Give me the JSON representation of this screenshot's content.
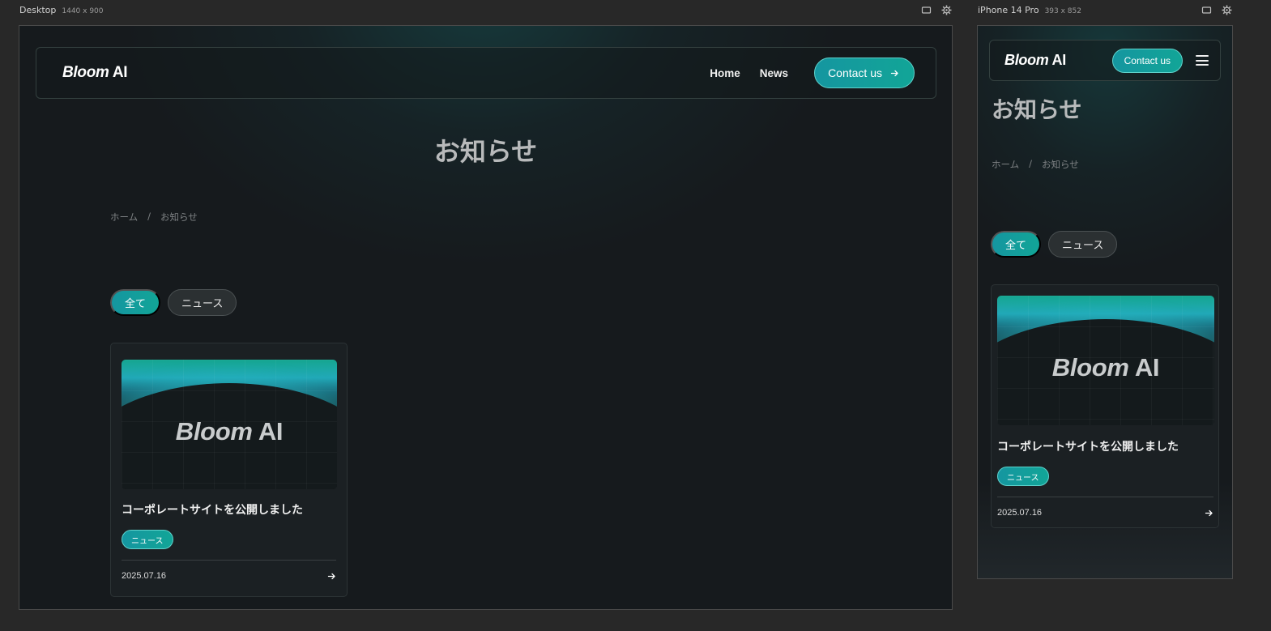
{
  "frames": {
    "desktop": {
      "label": "Desktop",
      "dims": "1440 x 900"
    },
    "mobile": {
      "label": "iPhone 14 Pro",
      "dims": "393 x 852"
    }
  },
  "site": {
    "logo_italic": "Bloom",
    "logo_rest": " AI",
    "nav": [
      {
        "label": "Home"
      },
      {
        "label": "News"
      }
    ],
    "contact_label": "Contact us"
  },
  "page": {
    "title": "お知らせ",
    "breadcrumb": {
      "home": "ホーム",
      "separator": "/",
      "current": "お知らせ"
    }
  },
  "filters": [
    {
      "label": "全て",
      "active": true
    },
    {
      "label": "ニュース",
      "active": false
    }
  ],
  "posts": [
    {
      "thumb_logo_italic": "Bloom",
      "thumb_logo_rest": " AI",
      "title": "コーポレートサイトを公開しました",
      "tag": "ニュース",
      "date": "2025.07.16"
    }
  ],
  "colors": {
    "accent": "#12a597",
    "accent_border": "#5fd3cc",
    "background": "#161a1d",
    "chrome_bg": "#282828"
  },
  "icons": {
    "arrow": "arrow-right-icon",
    "device": "device-frame-icon",
    "settings": "gear-icon",
    "menu": "hamburger-menu-icon"
  }
}
